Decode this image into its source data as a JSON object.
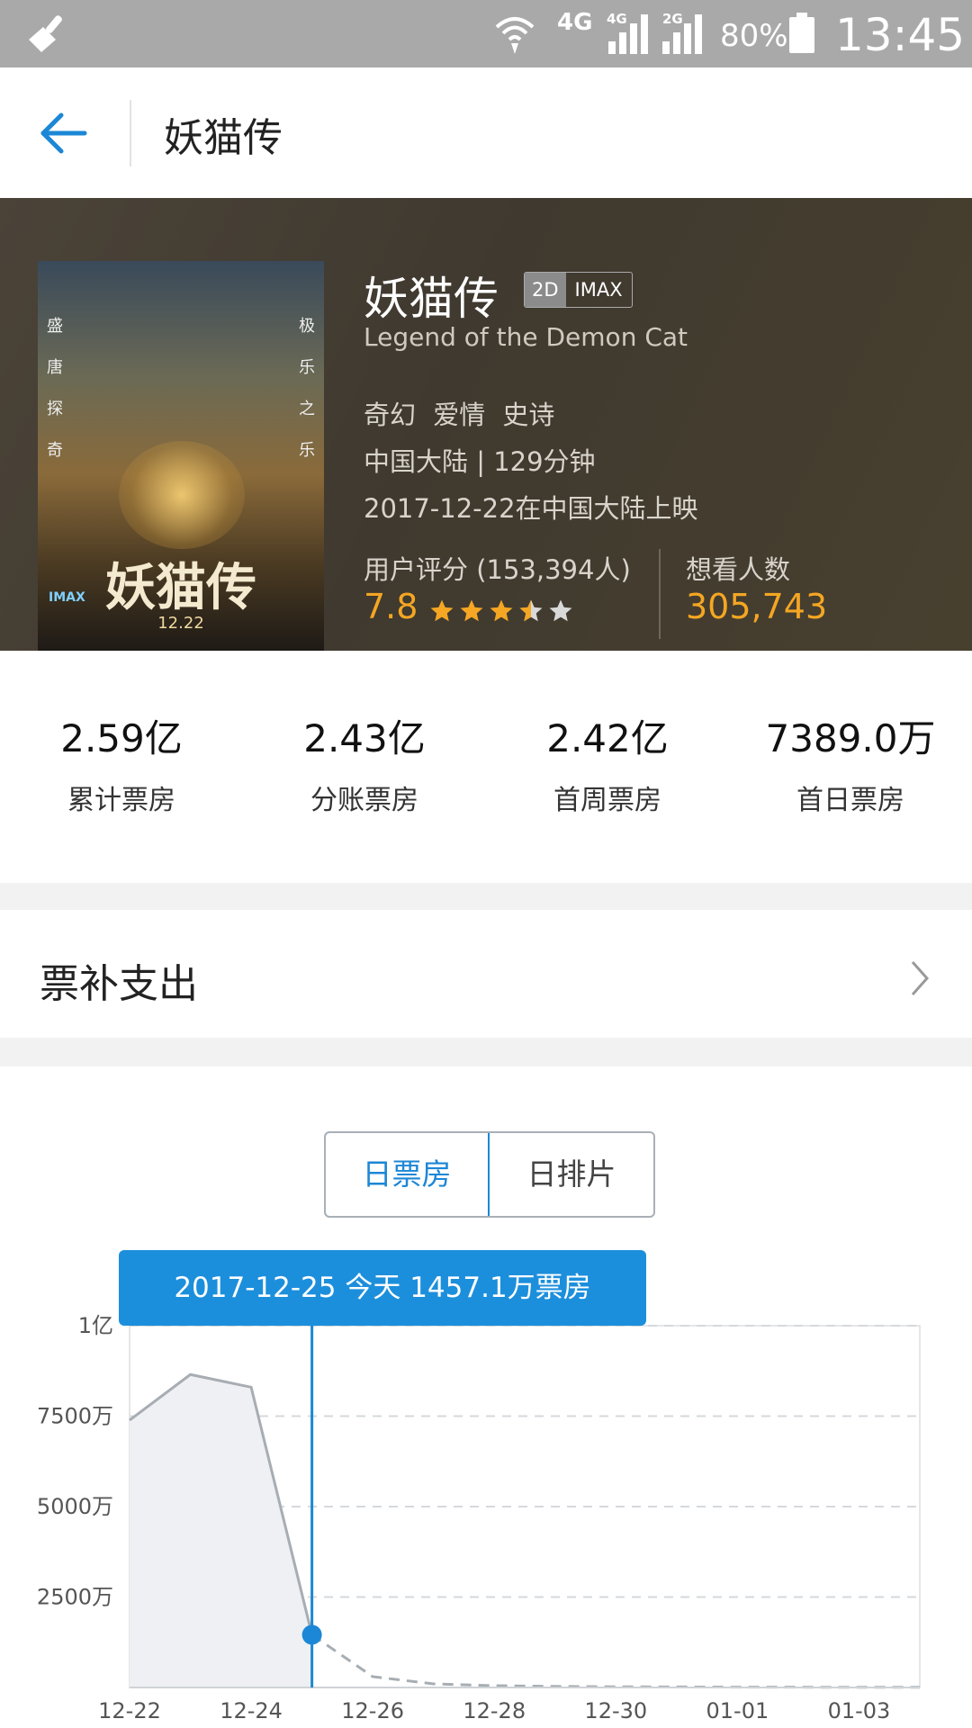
{
  "status_bar": {
    "network": "4G",
    "sim1_tag": "4G",
    "sim2_tag": "2G",
    "battery": "80%",
    "time": "13:45"
  },
  "header": {
    "title": "妖猫传"
  },
  "movie": {
    "title": "妖猫传",
    "tag_2d": "2D",
    "tag_imax": "IMAX",
    "english_title": "Legend of the Demon Cat",
    "genres": "奇幻 爱情 史诗",
    "origin_duration": "中国大陆 | 129分钟",
    "release": "2017-12-22在中国大陆上映",
    "rating_label": "用户评分 (153,394人)",
    "rating_score": "7.8",
    "rating_stars": 3.5,
    "want_label": "想看人数",
    "want_count": "305,743",
    "poster": {
      "title": "妖猫传",
      "date": "12.22",
      "imax": "IMAX",
      "side_left": "盛唐探奇",
      "side_right": "极乐之乐"
    }
  },
  "stats": [
    {
      "value": "2.59亿",
      "label": "累计票房"
    },
    {
      "value": "2.43亿",
      "label": "分账票房"
    },
    {
      "value": "2.42亿",
      "label": "首周票房"
    },
    {
      "value": "7389.0万",
      "label": "首日票房"
    }
  ],
  "subsidy": {
    "label": "票补支出"
  },
  "tabs": {
    "daily_box_office": "日票房",
    "daily_schedule": "日排片"
  },
  "tooltip": "2017-12-25 今天 1457.1万票房",
  "colors": {
    "accent": "#1c87d6",
    "orange": "#f5a623"
  },
  "chart_data": {
    "type": "area",
    "x": [
      "12-22",
      "12-23",
      "12-24",
      "12-25",
      "12-26",
      "12-27",
      "12-28",
      "12-29",
      "12-30",
      "12-31",
      "01-01",
      "01-02",
      "01-03",
      "01-04"
    ],
    "x_tick_labels": [
      "12-22",
      "12-24",
      "12-26",
      "12-28",
      "12-30",
      "01-01",
      "01-03"
    ],
    "y_tick_labels": [
      "1亿",
      "7500万",
      "5000万",
      "2500万"
    ],
    "y_ticks": [
      10000,
      7500,
      5000,
      2500
    ],
    "ylim": [
      0,
      10000
    ],
    "series": [
      {
        "actual": [
          7389,
          8650,
          8300,
          1457.1
        ],
        "forecast": [
          1457.1,
          300,
          100,
          50,
          30,
          20,
          15,
          10,
          8,
          5,
          5
        ]
      }
    ],
    "highlight_index": 3,
    "grid": true
  }
}
